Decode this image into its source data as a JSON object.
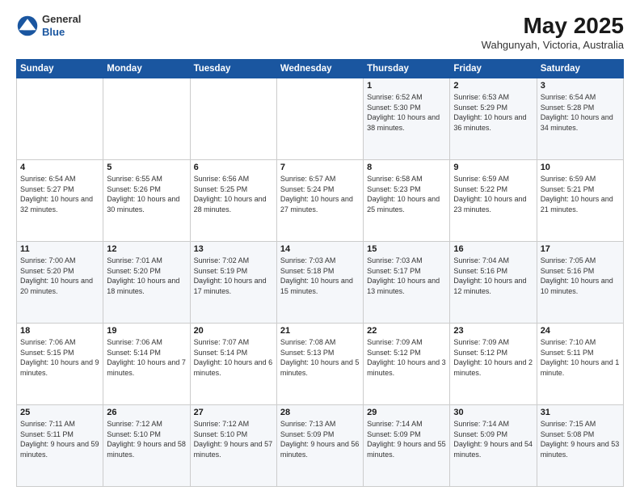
{
  "header": {
    "logo": {
      "line1": "General",
      "line2": "Blue"
    },
    "title": "May 2025",
    "location": "Wahgunyah, Victoria, Australia"
  },
  "weekdays": [
    "Sunday",
    "Monday",
    "Tuesday",
    "Wednesday",
    "Thursday",
    "Friday",
    "Saturday"
  ],
  "weeks": [
    [
      {
        "day": "",
        "sunrise": "",
        "sunset": "",
        "daylight": ""
      },
      {
        "day": "",
        "sunrise": "",
        "sunset": "",
        "daylight": ""
      },
      {
        "day": "",
        "sunrise": "",
        "sunset": "",
        "daylight": ""
      },
      {
        "day": "",
        "sunrise": "",
        "sunset": "",
        "daylight": ""
      },
      {
        "day": "1",
        "sunrise": "Sunrise: 6:52 AM",
        "sunset": "Sunset: 5:30 PM",
        "daylight": "Daylight: 10 hours and 38 minutes."
      },
      {
        "day": "2",
        "sunrise": "Sunrise: 6:53 AM",
        "sunset": "Sunset: 5:29 PM",
        "daylight": "Daylight: 10 hours and 36 minutes."
      },
      {
        "day": "3",
        "sunrise": "Sunrise: 6:54 AM",
        "sunset": "Sunset: 5:28 PM",
        "daylight": "Daylight: 10 hours and 34 minutes."
      }
    ],
    [
      {
        "day": "4",
        "sunrise": "Sunrise: 6:54 AM",
        "sunset": "Sunset: 5:27 PM",
        "daylight": "Daylight: 10 hours and 32 minutes."
      },
      {
        "day": "5",
        "sunrise": "Sunrise: 6:55 AM",
        "sunset": "Sunset: 5:26 PM",
        "daylight": "Daylight: 10 hours and 30 minutes."
      },
      {
        "day": "6",
        "sunrise": "Sunrise: 6:56 AM",
        "sunset": "Sunset: 5:25 PM",
        "daylight": "Daylight: 10 hours and 28 minutes."
      },
      {
        "day": "7",
        "sunrise": "Sunrise: 6:57 AM",
        "sunset": "Sunset: 5:24 PM",
        "daylight": "Daylight: 10 hours and 27 minutes."
      },
      {
        "day": "8",
        "sunrise": "Sunrise: 6:58 AM",
        "sunset": "Sunset: 5:23 PM",
        "daylight": "Daylight: 10 hours and 25 minutes."
      },
      {
        "day": "9",
        "sunrise": "Sunrise: 6:59 AM",
        "sunset": "Sunset: 5:22 PM",
        "daylight": "Daylight: 10 hours and 23 minutes."
      },
      {
        "day": "10",
        "sunrise": "Sunrise: 6:59 AM",
        "sunset": "Sunset: 5:21 PM",
        "daylight": "Daylight: 10 hours and 21 minutes."
      }
    ],
    [
      {
        "day": "11",
        "sunrise": "Sunrise: 7:00 AM",
        "sunset": "Sunset: 5:20 PM",
        "daylight": "Daylight: 10 hours and 20 minutes."
      },
      {
        "day": "12",
        "sunrise": "Sunrise: 7:01 AM",
        "sunset": "Sunset: 5:20 PM",
        "daylight": "Daylight: 10 hours and 18 minutes."
      },
      {
        "day": "13",
        "sunrise": "Sunrise: 7:02 AM",
        "sunset": "Sunset: 5:19 PM",
        "daylight": "Daylight: 10 hours and 17 minutes."
      },
      {
        "day": "14",
        "sunrise": "Sunrise: 7:03 AM",
        "sunset": "Sunset: 5:18 PM",
        "daylight": "Daylight: 10 hours and 15 minutes."
      },
      {
        "day": "15",
        "sunrise": "Sunrise: 7:03 AM",
        "sunset": "Sunset: 5:17 PM",
        "daylight": "Daylight: 10 hours and 13 minutes."
      },
      {
        "day": "16",
        "sunrise": "Sunrise: 7:04 AM",
        "sunset": "Sunset: 5:16 PM",
        "daylight": "Daylight: 10 hours and 12 minutes."
      },
      {
        "day": "17",
        "sunrise": "Sunrise: 7:05 AM",
        "sunset": "Sunset: 5:16 PM",
        "daylight": "Daylight: 10 hours and 10 minutes."
      }
    ],
    [
      {
        "day": "18",
        "sunrise": "Sunrise: 7:06 AM",
        "sunset": "Sunset: 5:15 PM",
        "daylight": "Daylight: 10 hours and 9 minutes."
      },
      {
        "day": "19",
        "sunrise": "Sunrise: 7:06 AM",
        "sunset": "Sunset: 5:14 PM",
        "daylight": "Daylight: 10 hours and 7 minutes."
      },
      {
        "day": "20",
        "sunrise": "Sunrise: 7:07 AM",
        "sunset": "Sunset: 5:14 PM",
        "daylight": "Daylight: 10 hours and 6 minutes."
      },
      {
        "day": "21",
        "sunrise": "Sunrise: 7:08 AM",
        "sunset": "Sunset: 5:13 PM",
        "daylight": "Daylight: 10 hours and 5 minutes."
      },
      {
        "day": "22",
        "sunrise": "Sunrise: 7:09 AM",
        "sunset": "Sunset: 5:12 PM",
        "daylight": "Daylight: 10 hours and 3 minutes."
      },
      {
        "day": "23",
        "sunrise": "Sunrise: 7:09 AM",
        "sunset": "Sunset: 5:12 PM",
        "daylight": "Daylight: 10 hours and 2 minutes."
      },
      {
        "day": "24",
        "sunrise": "Sunrise: 7:10 AM",
        "sunset": "Sunset: 5:11 PM",
        "daylight": "Daylight: 10 hours and 1 minute."
      }
    ],
    [
      {
        "day": "25",
        "sunrise": "Sunrise: 7:11 AM",
        "sunset": "Sunset: 5:11 PM",
        "daylight": "Daylight: 9 hours and 59 minutes."
      },
      {
        "day": "26",
        "sunrise": "Sunrise: 7:12 AM",
        "sunset": "Sunset: 5:10 PM",
        "daylight": "Daylight: 9 hours and 58 minutes."
      },
      {
        "day": "27",
        "sunrise": "Sunrise: 7:12 AM",
        "sunset": "Sunset: 5:10 PM",
        "daylight": "Daylight: 9 hours and 57 minutes."
      },
      {
        "day": "28",
        "sunrise": "Sunrise: 7:13 AM",
        "sunset": "Sunset: 5:09 PM",
        "daylight": "Daylight: 9 hours and 56 minutes."
      },
      {
        "day": "29",
        "sunrise": "Sunrise: 7:14 AM",
        "sunset": "Sunset: 5:09 PM",
        "daylight": "Daylight: 9 hours and 55 minutes."
      },
      {
        "day": "30",
        "sunrise": "Sunrise: 7:14 AM",
        "sunset": "Sunset: 5:09 PM",
        "daylight": "Daylight: 9 hours and 54 minutes."
      },
      {
        "day": "31",
        "sunrise": "Sunrise: 7:15 AM",
        "sunset": "Sunset: 5:08 PM",
        "daylight": "Daylight: 9 hours and 53 minutes."
      }
    ]
  ]
}
